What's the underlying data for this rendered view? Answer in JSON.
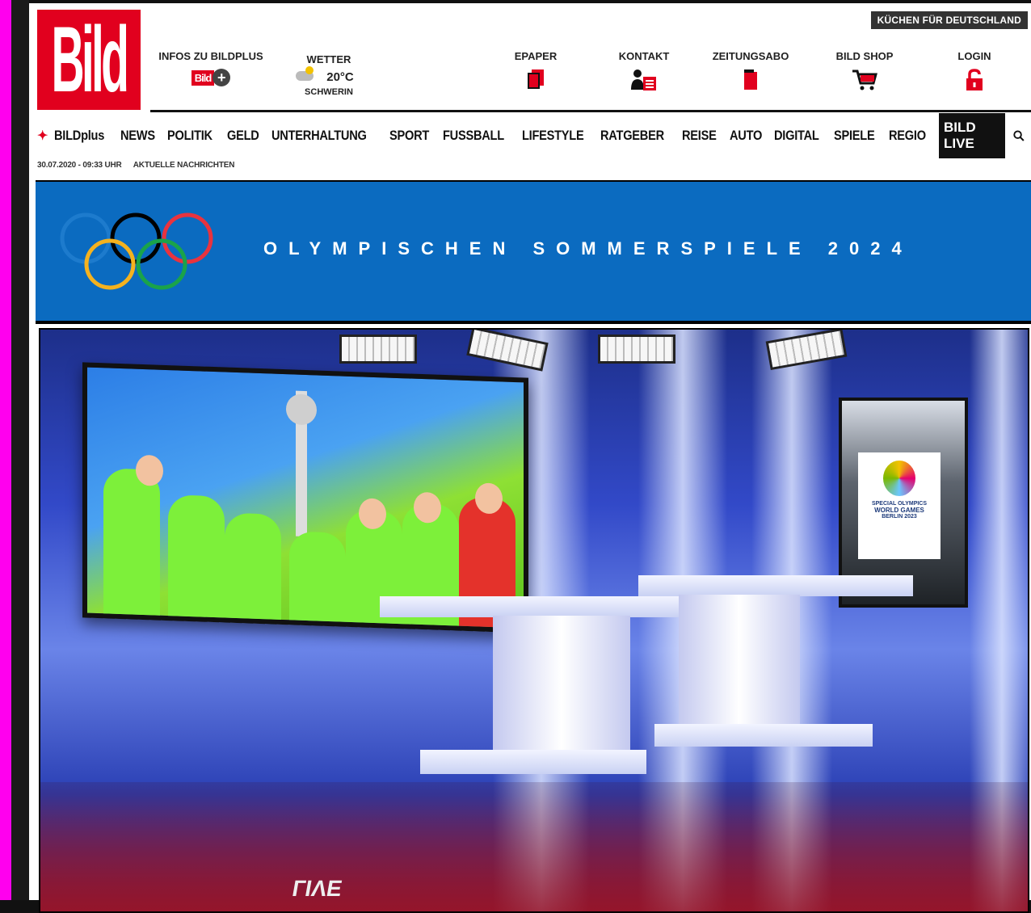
{
  "header": {
    "logo_text": "Bild",
    "promo_label": "KÜCHEN FÜR DEUTSCHLAND",
    "infos_label": "INFOS ZU BILDPLUS",
    "bildplus_badge": "Bild",
    "weather": {
      "label": "WETTER",
      "temp": "20°C",
      "city": "SCHWERIN"
    },
    "links": [
      {
        "label": "EPAPER",
        "icon": "newspaper-icon"
      },
      {
        "label": "KONTAKT",
        "icon": "contact-icon"
      },
      {
        "label": "ZEITUNGSABO",
        "icon": "subscription-icon"
      },
      {
        "label": "BILD SHOP",
        "icon": "cart-icon"
      },
      {
        "label": "LOGIN",
        "icon": "lock-icon"
      }
    ]
  },
  "nav": {
    "items": [
      "BILDplus",
      "NEWS",
      "POLITIK",
      "GELD",
      "UNTERHALTUNG",
      "SPORT",
      "FUSSBALL",
      "LIFESTYLE",
      "RATGEBER",
      "REISE",
      "AUTO",
      "DIGITAL",
      "SPIELE",
      "REGIO"
    ],
    "live": "BILD LIVE"
  },
  "subline": {
    "date": "30.07.2020 - 09:33 UHR",
    "section": "AKTUELLE NACHRICHTEN"
  },
  "banner": {
    "title": "OLYMPISCHEN SOMMERSPIELE 2024"
  },
  "photo": {
    "sign_line1": "SPECIAL OLYMPICS",
    "sign_line2": "WORLD GAMES",
    "sign_line3": "BERLIN 2023",
    "floor_text": "ГIΛE"
  },
  "colors": {
    "brand_red": "#e1001e",
    "banner_blue": "#0b6bc0",
    "side_magenta": "#ff00ee"
  }
}
